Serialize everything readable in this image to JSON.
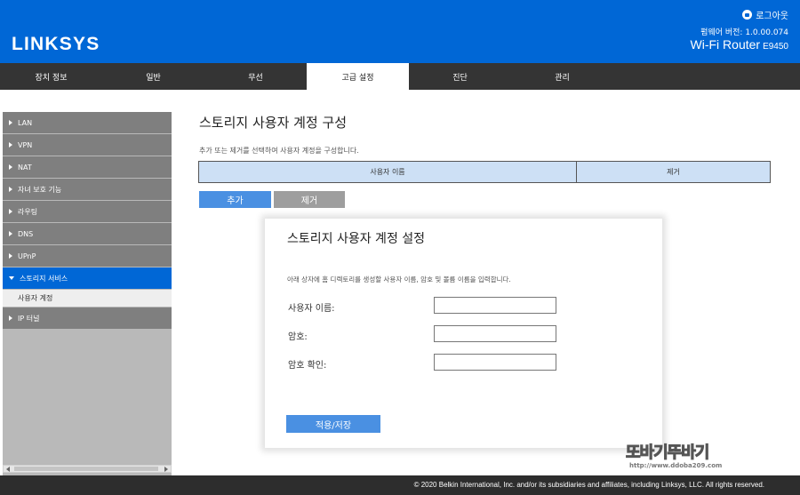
{
  "header": {
    "logo": "LINKSYS",
    "logout_label": "로그아웃",
    "firmware": "펌웨어 버전: 1.0.00.074",
    "model_name": "Wi-Fi Router",
    "model_number": "E9450"
  },
  "nav": {
    "tabs": [
      {
        "label": "장치 정보",
        "active": false
      },
      {
        "label": "일반",
        "active": false
      },
      {
        "label": "무선",
        "active": false
      },
      {
        "label": "고급 설정",
        "active": true
      },
      {
        "label": "진단",
        "active": false
      },
      {
        "label": "관리",
        "active": false
      }
    ]
  },
  "sidebar": {
    "items": [
      {
        "label": "LAN"
      },
      {
        "label": "VPN"
      },
      {
        "label": "NAT"
      },
      {
        "label": "자녀 보호 기능"
      },
      {
        "label": "라우팅"
      },
      {
        "label": "DNS"
      },
      {
        "label": "UPnP"
      },
      {
        "label": "스토리지 서비스",
        "active": true
      },
      {
        "label": "사용자 계정",
        "sub": true
      },
      {
        "label": "IP 터널"
      }
    ]
  },
  "main": {
    "title": "스토리지 사용자 계정 구성",
    "description": "추가 또는 제거를 선택하여 사용자 계정을 구성합니다.",
    "table": {
      "col_username": "사용자 이름",
      "col_remove": "제거"
    },
    "add_label": "추가",
    "remove_label": "제거"
  },
  "modal": {
    "title": "스토리지 사용자 계정 설정",
    "description": "아래 상자에 홈 디렉토리를 생성할 사용자 이름, 암호 및 볼륨 이름을 입력합니다.",
    "fields": [
      {
        "label": "사용자 이름:",
        "value": ""
      },
      {
        "label": "암호:",
        "value": ""
      },
      {
        "label": "암호 확인:",
        "value": ""
      }
    ],
    "apply_label": "적용/저장"
  },
  "footer": {
    "copyright": "© 2020 Belkin International, Inc. and/or its subsidiaries and affiliates, including Linksys, LLC. All rights reserved."
  },
  "watermark": {
    "text": "또바기뚜바기",
    "url": "http://www.ddoba209.com"
  }
}
